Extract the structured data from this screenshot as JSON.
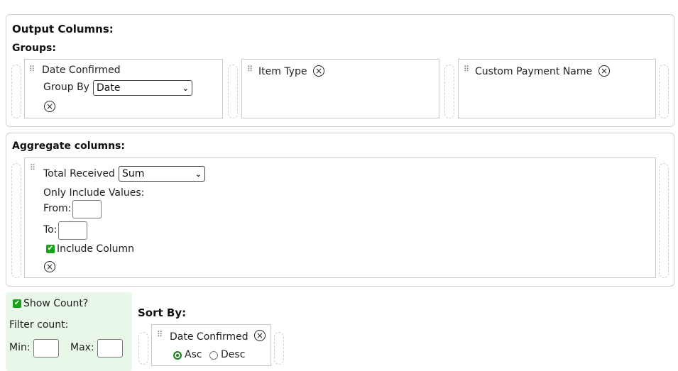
{
  "output": {
    "title": "Output Columns:",
    "groups_label": "Groups:",
    "groups": [
      {
        "name": "Date Confirmed",
        "group_by_label": "Group By",
        "group_by_value": "Date"
      },
      {
        "name": "Item Type"
      },
      {
        "name": "Custom Payment Name"
      }
    ]
  },
  "aggregate": {
    "title": "Aggregate columns:",
    "column": {
      "name": "Total Received",
      "function": "Sum",
      "only_include_label": "Only Include Values:",
      "from_label": "From:",
      "from_value": "",
      "to_label": "To:",
      "to_value": "",
      "include_label": "Include Column",
      "include_checked": true
    }
  },
  "count": {
    "show_label": "Show Count?",
    "show_checked": true,
    "filter_label": "Filter count:",
    "min_label": "Min:",
    "min_value": "",
    "max_label": "Max:",
    "max_value": ""
  },
  "sort": {
    "title": "Sort By:",
    "item": {
      "name": "Date Confirmed",
      "asc_label": "Asc",
      "desc_label": "Desc",
      "selected": "Asc"
    }
  },
  "icons": {
    "close": "close-circle-icon",
    "grip": "drag-handle-icon",
    "chevron": "chevron-down-icon",
    "check": "checkmark-icon"
  },
  "colors": {
    "accent": "#18a018",
    "panel_bg": "#e8f7e8",
    "border": "#cfcfcf"
  }
}
